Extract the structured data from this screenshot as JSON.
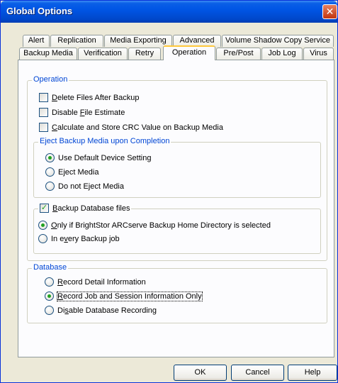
{
  "window": {
    "title": "Global Options"
  },
  "tabs_back": [
    "Alert",
    "Replication",
    "Media Exporting",
    "Advanced",
    "Volume Shadow Copy Service"
  ],
  "tabs_front": [
    "Backup Media",
    "Verification",
    "Retry",
    "Operation",
    "Pre/Post",
    "Job Log",
    "Virus"
  ],
  "active_tab": "Operation",
  "operation": {
    "group_label": "Operation",
    "delete_files": {
      "prefix": "",
      "key": "D",
      "rest": "elete Files After Backup",
      "checked": false
    },
    "disable_estimate": {
      "prefix": "Disable ",
      "key": "F",
      "rest": "ile Estimate",
      "checked": false
    },
    "crc": {
      "prefix": "",
      "key": "C",
      "rest": "alculate and Store CRC Value on Backup Media",
      "checked": false
    },
    "eject": {
      "group_label": "Eject Backup Media upon Completion",
      "options": [
        {
          "prefix": "Use Default Device Setting",
          "key": "",
          "rest": "",
          "selected": true
        },
        {
          "prefix": "E",
          "key": "j",
          "rest": "ect Media",
          "selected": false
        },
        {
          "prefix": "Do not Eject Media",
          "key": "",
          "rest": "",
          "selected": false
        }
      ]
    },
    "backup_db": {
      "prefix": "",
      "key": "B",
      "rest": "ackup Database files",
      "checked": true,
      "options": [
        {
          "prefix": "",
          "key": "O",
          "rest": "nly if BrightStor ARCserve Backup Home Directory is selected",
          "selected": true
        },
        {
          "prefix": "In e",
          "key": "v",
          "rest": "ery Backup job",
          "selected": false
        }
      ]
    }
  },
  "database": {
    "group_label": "Database",
    "options": [
      {
        "prefix": "",
        "key": "R",
        "rest": "ecord Detail Information",
        "selected": false
      },
      {
        "prefix": "",
        "key": "R",
        "rest": "ecord Job and Session Information Only",
        "selected": true
      },
      {
        "prefix": "Di",
        "key": "s",
        "rest": "able Database Recording",
        "selected": false
      }
    ]
  },
  "buttons": {
    "ok": "OK",
    "cancel": "Cancel",
    "help": "Help"
  },
  "colors": {
    "title_bar": "#0055E5",
    "group_label": "#0046D5",
    "active_tab_accent": "#FFC83C"
  }
}
